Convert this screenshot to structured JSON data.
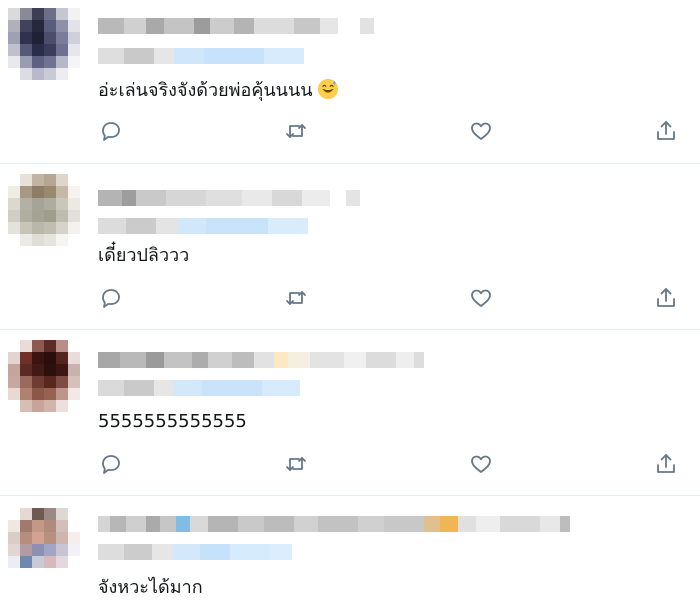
{
  "colors": {
    "text": "#14171a",
    "icon": "#657786",
    "divider": "#e6ecf0",
    "blur_grey": "#c8c8c8",
    "blur_blue": "#cfe6fb"
  },
  "icons": {
    "reply": "reply-icon",
    "retweet": "retweet-icon",
    "like": "heart-icon",
    "share": "share-icon",
    "emoji": "grinning-face-with-sweat-emoji"
  },
  "tweets": [
    {
      "text": "อ่ะเล่นจริงจังด้วยพ่อคุ้นนนน",
      "has_emoji": true
    },
    {
      "text": "เดี๋ยวปลิววว",
      "has_emoji": false
    },
    {
      "text": "5555555555555",
      "has_emoji": false
    },
    {
      "text": "จังหวะได้มาก",
      "has_emoji": false
    }
  ]
}
